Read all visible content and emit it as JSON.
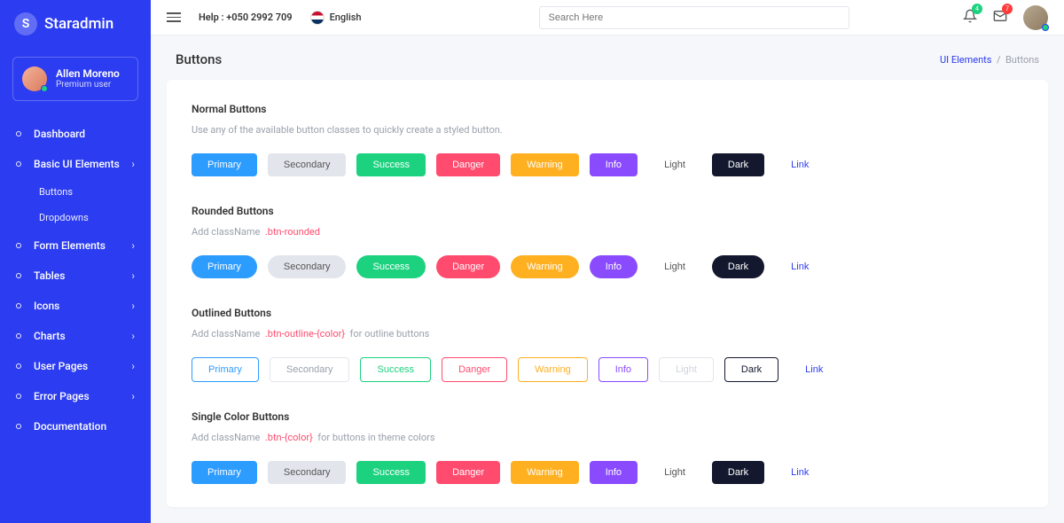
{
  "brand": {
    "initial": "S",
    "name": "Staradmin"
  },
  "user": {
    "name": "Allen Moreno",
    "role": "Premium user"
  },
  "nav": {
    "dashboard": "Dashboard",
    "basic_ui": "Basic UI Elements",
    "sub_buttons": "Buttons",
    "sub_dropdowns": "Dropdowns",
    "form_elements": "Form Elements",
    "tables": "Tables",
    "icons": "Icons",
    "charts": "Charts",
    "user_pages": "User Pages",
    "error_pages": "Error Pages",
    "documentation": "Documentation"
  },
  "topbar": {
    "help": "Help : +050 2992 709",
    "language": "English",
    "search_placeholder": "Search Here",
    "notif_count": "4",
    "msg_count": "7"
  },
  "page": {
    "title": "Buttons",
    "crumb_parent": "UI Elements",
    "crumb_sep": "/",
    "crumb_current": "Buttons"
  },
  "sections": {
    "normal": {
      "title": "Normal Buttons",
      "desc": "Use any of the available button classes to quickly create a styled button."
    },
    "rounded": {
      "title": "Rounded Buttons",
      "desc_pre": "Add className",
      "desc_code": ".btn-rounded"
    },
    "outlined": {
      "title": "Outlined Buttons",
      "desc_pre": "Add className",
      "desc_code": ".btn-outline-{color}",
      "desc_post": "for outline buttons"
    },
    "single": {
      "title": "Single Color Buttons",
      "desc_pre": "Add className",
      "desc_code": ".btn-{color}",
      "desc_post": "for buttons in theme colors"
    }
  },
  "btn": {
    "primary": "Primary",
    "secondary": "Secondary",
    "success": "Success",
    "danger": "Danger",
    "warning": "Warning",
    "info": "Info",
    "light": "Light",
    "dark": "Dark",
    "link": "Link"
  }
}
